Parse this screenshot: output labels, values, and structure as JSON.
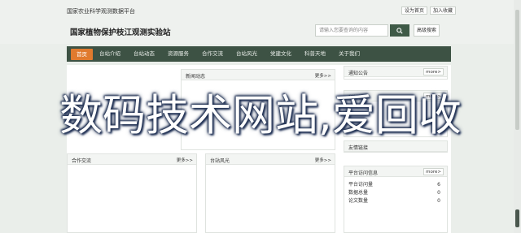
{
  "topbar": {
    "site_name": "国家农业科学观测数据平台",
    "links": [
      "设为首页",
      "加入收藏"
    ]
  },
  "header": {
    "title": "国家植物保护枝江观测实验站",
    "search_placeholder": "请输入您要查询的内容",
    "advanced_search": "高级搜索"
  },
  "nav": {
    "items": [
      "首页",
      "台站介绍",
      "台站动态",
      "资源服务",
      "合作交流",
      "台站风光",
      "党建文化",
      "科普天地",
      "关于我们"
    ]
  },
  "panels": {
    "news": {
      "title": "新闻动态",
      "more": "更多>>"
    },
    "notice": {
      "title": "通知公告",
      "more": "more>"
    },
    "popular": {
      "title": "科普普及",
      "more": "more>"
    },
    "cooperation": {
      "title": "合作交流",
      "more": "更多>>"
    },
    "scenery": {
      "title": "台站风光",
      "more": "更多>>"
    },
    "links": {
      "title": "友情链接"
    },
    "stats": {
      "title": "平台访问信息",
      "more": "more>",
      "rows": [
        {
          "label": "平台访问量",
          "value": "6"
        },
        {
          "label": "数据总量",
          "value": "0"
        },
        {
          "label": "论文数量",
          "value": "0"
        }
      ]
    }
  },
  "overlay": {
    "text": "数码技术网站,爱回收"
  },
  "colors": {
    "nav_bg": "#3d5244",
    "nav_active": "#e07a2e",
    "search_btn": "#3f5a47"
  }
}
